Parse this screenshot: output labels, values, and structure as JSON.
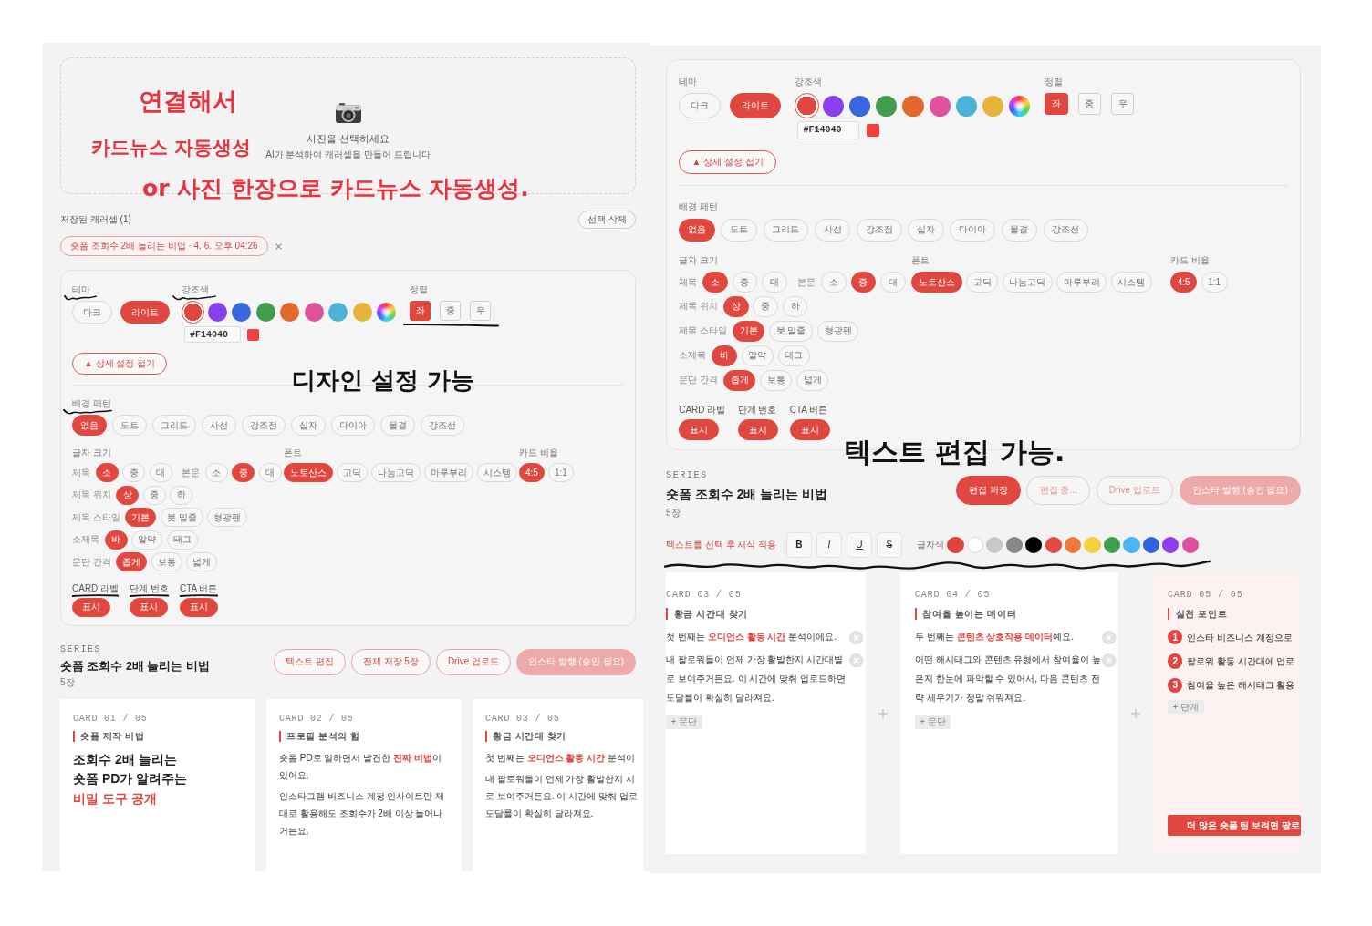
{
  "screens": [
    {
      "editing": false,
      "upload": {
        "title": "사진을 선택하세요",
        "subtitle": "AI가 분석하여 캐러셀을 만들어 드립니다"
      },
      "saved": {
        "label": "저장된 캐러셀 (1)",
        "delete_button": "선택 삭제",
        "items": [
          {
            "label": "숏폼 조회수 2배 늘리는 비법 · 4. 6. 오후 04:26"
          }
        ]
      },
      "settings": {
        "theme": {
          "label": "테마",
          "options": [
            {
              "label": "다크",
              "selected": false
            },
            {
              "label": "라이트",
              "selected": true
            }
          ]
        },
        "accent": {
          "label": "강조색",
          "swatches": [
            {
              "kind": "solid",
              "color": "#e2473f",
              "selected": true
            },
            {
              "kind": "solid",
              "color": "#8a40ee",
              "selected": false
            },
            {
              "kind": "solid",
              "color": "#3a66df",
              "selected": false
            },
            {
              "kind": "solid",
              "color": "#3f9d4b",
              "selected": false
            },
            {
              "kind": "solid",
              "color": "#e2682b",
              "selected": false
            },
            {
              "kind": "solid",
              "color": "#e0529c",
              "selected": false
            },
            {
              "kind": "solid",
              "color": "#4bb3d7",
              "selected": false
            },
            {
              "kind": "solid",
              "color": "#e6b43b",
              "selected": false
            },
            {
              "kind": "picker",
              "selected": false
            }
          ],
          "hex": "#F14040"
        },
        "align": {
          "label": "정렬",
          "options": [
            {
              "label": "좌",
              "selected": true
            },
            {
              "label": "중",
              "selected": false
            },
            {
              "label": "우",
              "selected": false
            }
          ]
        },
        "collapse_button": "▲ 상세 설정 접기",
        "pattern": {
          "label": "배경 패턴",
          "options": [
            {
              "label": "없음",
              "selected": true
            },
            {
              "label": "도트",
              "selected": false
            },
            {
              "label": "그리드",
              "selected": false
            },
            {
              "label": "사선",
              "selected": false
            },
            {
              "label": "강조점",
              "selected": false
            },
            {
              "label": "십자",
              "selected": false
            },
            {
              "label": "다이아",
              "selected": false
            },
            {
              "label": "물결",
              "selected": false
            },
            {
              "label": "강조선",
              "selected": false
            }
          ]
        },
        "text_options": {
          "label": "글자 크기",
          "rows": [
            {
              "groups": [
                {
                  "label": "제목",
                  "options": [
                    {
                      "label": "소",
                      "selected": true
                    },
                    {
                      "label": "중",
                      "selected": false
                    },
                    {
                      "label": "대",
                      "selected": false
                    }
                  ]
                },
                {
                  "label": "본문",
                  "options": [
                    {
                      "label": "소",
                      "selected": false
                    },
                    {
                      "label": "중",
                      "selected": true
                    },
                    {
                      "label": "대",
                      "selected": false
                    }
                  ]
                }
              ]
            },
            {
              "groups": [
                {
                  "label": "제목 위치",
                  "options": [
                    {
                      "label": "상",
                      "selected": true
                    },
                    {
                      "label": "중",
                      "selected": false
                    },
                    {
                      "label": "하",
                      "selected": false
                    }
                  ]
                }
              ]
            },
            {
              "groups": [
                {
                  "label": "제목 스타일",
                  "options": [
                    {
                      "label": "기본",
                      "selected": true
                    },
                    {
                      "label": "붓 밑줄",
                      "selected": false
                    },
                    {
                      "label": "형광펜",
                      "selected": false
                    }
                  ]
                }
              ]
            },
            {
              "groups": [
                {
                  "label": "소제목",
                  "options": [
                    {
                      "label": "바",
                      "selected": true
                    },
                    {
                      "label": "알약",
                      "selected": false
                    },
                    {
                      "label": "태그",
                      "selected": false
                    }
                  ]
                }
              ]
            },
            {
              "groups": [
                {
                  "label": "문단 간격",
                  "options": [
                    {
                      "label": "좁게",
                      "selected": true
                    },
                    {
                      "label": "보통",
                      "selected": false
                    },
                    {
                      "label": "넓게",
                      "selected": false
                    }
                  ]
                }
              ]
            }
          ]
        },
        "font": {
          "label": "폰트",
          "options": [
            {
              "label": "노토산스",
              "selected": true
            },
            {
              "label": "고딕",
              "selected": false
            },
            {
              "label": "나눔고딕",
              "selected": false
            },
            {
              "label": "마루부리",
              "selected": false
            },
            {
              "label": "시스템",
              "selected": false
            }
          ]
        },
        "ratio": {
          "label": "카드 비율",
          "options": [
            {
              "label": "4:5",
              "selected": true
            },
            {
              "label": "1:1",
              "selected": false
            }
          ]
        },
        "toggles": [
          {
            "label": "CARD 라벨",
            "button": "표시",
            "on": true
          },
          {
            "label": "단계 번호",
            "button": "표시",
            "on": true
          },
          {
            "label": "CTA 버튼",
            "button": "표시",
            "on": true
          }
        ]
      },
      "series": {
        "eyebrow": "SERIES",
        "title": "숏폼 조회수 2배 늘리는 비법",
        "count": "5장",
        "buttons": [
          {
            "label": "텍스트 편집",
            "kind": "outline"
          },
          {
            "label": "전체 저장 5장",
            "kind": "outline"
          },
          {
            "label": "Drive 업로드",
            "kind": "outline"
          },
          {
            "label": "인스타 발행 (승인 필요)",
            "kind": "disabled"
          }
        ]
      },
      "cards": [
        {
          "kind": "cover",
          "label": "CARD 01 / 05",
          "tag": "숏폼 제작 비법",
          "title_lines": [
            {
              "text": "조회수 2배 늘리는",
              "accent": false
            },
            {
              "text": "숏폼 PD가 알려주는",
              "accent": false
            },
            {
              "text": "비밀 도구 공개",
              "accent": true
            }
          ]
        },
        {
          "kind": "text",
          "label": "CARD 02 / 05",
          "tag": "프로필 분석의 힘",
          "paragraphs": [
            "숏폼 PD로 일하면서 발견한 **진짜 비법**이 있어요.",
            "인스타그램 비즈니스 계정 인사이트만 제대로 활용해도 조회수가 2배 이상 늘어나거든요."
          ]
        },
        {
          "kind": "text",
          "label": "CARD 03 / 05",
          "tag": "황금 시간대 찾기",
          "paragraphs": [
            "첫 번째는 **오디언스 활동 시간** 분석이",
            "내 팔로워들이 언제 가장 활발한지 시\n로 보여주거든요. 이 시간에 맞춰 업로\n도달률이 확실히 달라져요."
          ]
        }
      ]
    },
    {
      "editing": true,
      "settings": {
        "theme": {
          "label": "테마",
          "options": [
            {
              "label": "다크",
              "selected": false
            },
            {
              "label": "라이트",
              "selected": true
            }
          ]
        },
        "accent": {
          "label": "강조색",
          "swatches": [
            {
              "kind": "solid",
              "color": "#e2473f",
              "selected": true
            },
            {
              "kind": "solid",
              "color": "#8a40ee",
              "selected": false
            },
            {
              "kind": "solid",
              "color": "#3a66df",
              "selected": false
            },
            {
              "kind": "solid",
              "color": "#3f9d4b",
              "selected": false
            },
            {
              "kind": "solid",
              "color": "#e2682b",
              "selected": false
            },
            {
              "kind": "solid",
              "color": "#e0529c",
              "selected": false
            },
            {
              "kind": "solid",
              "color": "#4bb3d7",
              "selected": false
            },
            {
              "kind": "solid",
              "color": "#e6b43b",
              "selected": false
            },
            {
              "kind": "picker",
              "selected": false
            }
          ],
          "hex": "#F14040"
        },
        "align": {
          "label": "정렬",
          "options": [
            {
              "label": "좌",
              "selected": true
            },
            {
              "label": "중",
              "selected": false
            },
            {
              "label": "우",
              "selected": false
            }
          ]
        },
        "collapse_button": "▲ 상세 설정 접기",
        "pattern": {
          "label": "배경 패턴",
          "options": [
            {
              "label": "없음",
              "selected": true
            },
            {
              "label": "도트",
              "selected": false
            },
            {
              "label": "그리드",
              "selected": false
            },
            {
              "label": "사선",
              "selected": false
            },
            {
              "label": "강조점",
              "selected": false
            },
            {
              "label": "십자",
              "selected": false
            },
            {
              "label": "다이아",
              "selected": false
            },
            {
              "label": "물결",
              "selected": false
            },
            {
              "label": "강조선",
              "selected": false
            }
          ]
        },
        "text_options": {
          "label": "글자 크기",
          "rows": [
            {
              "groups": [
                {
                  "label": "제목",
                  "options": [
                    {
                      "label": "소",
                      "selected": true
                    },
                    {
                      "label": "중",
                      "selected": false
                    },
                    {
                      "label": "대",
                      "selected": false
                    }
                  ]
                },
                {
                  "label": "본문",
                  "options": [
                    {
                      "label": "소",
                      "selected": false
                    },
                    {
                      "label": "중",
                      "selected": true
                    },
                    {
                      "label": "대",
                      "selected": false
                    }
                  ]
                }
              ]
            },
            {
              "groups": [
                {
                  "label": "제목 위치",
                  "options": [
                    {
                      "label": "상",
                      "selected": true
                    },
                    {
                      "label": "중",
                      "selected": false
                    },
                    {
                      "label": "하",
                      "selected": false
                    }
                  ]
                }
              ]
            },
            {
              "groups": [
                {
                  "label": "제목 스타일",
                  "options": [
                    {
                      "label": "기본",
                      "selected": true
                    },
                    {
                      "label": "붓 밑줄",
                      "selected": false
                    },
                    {
                      "label": "형광펜",
                      "selected": false
                    }
                  ]
                }
              ]
            },
            {
              "groups": [
                {
                  "label": "소제목",
                  "options": [
                    {
                      "label": "바",
                      "selected": true
                    },
                    {
                      "label": "알약",
                      "selected": false
                    },
                    {
                      "label": "태그",
                      "selected": false
                    }
                  ]
                }
              ]
            },
            {
              "groups": [
                {
                  "label": "문단 간격",
                  "options": [
                    {
                      "label": "좁게",
                      "selected": true
                    },
                    {
                      "label": "보통",
                      "selected": false
                    },
                    {
                      "label": "넓게",
                      "selected": false
                    }
                  ]
                }
              ]
            }
          ]
        },
        "font": {
          "label": "폰트",
          "options": [
            {
              "label": "노토산스",
              "selected": true
            },
            {
              "label": "고딕",
              "selected": false
            },
            {
              "label": "나눔고딕",
              "selected": false
            },
            {
              "label": "마루부리",
              "selected": false
            },
            {
              "label": "시스템",
              "selected": false
            }
          ]
        },
        "ratio": {
          "label": "카드 비율",
          "options": [
            {
              "label": "4:5",
              "selected": true
            },
            {
              "label": "1:1",
              "selected": false
            }
          ]
        },
        "toggles": [
          {
            "label": "CARD 라벨",
            "button": "표시",
            "on": true
          },
          {
            "label": "단계 번호",
            "button": "표시",
            "on": true
          },
          {
            "label": "CTA 버튼",
            "button": "표시",
            "on": true
          }
        ]
      },
      "series": {
        "eyebrow": "SERIES",
        "title": "숏폼 조회수 2배 늘리는 비법",
        "count": "5장",
        "buttons": [
          {
            "label": "편집 저장",
            "kind": "primary"
          },
          {
            "label": "편집 중...",
            "kind": "muted"
          },
          {
            "label": "Drive 업로드",
            "kind": "muted"
          },
          {
            "label": "인스타 발행 (승인 필요)",
            "kind": "disabled"
          }
        ]
      },
      "format_bar": {
        "hint": "텍스트를 선택 후 서식 적용",
        "styles": [
          {
            "label": "B",
            "kind": "bold"
          },
          {
            "label": "I",
            "kind": "italic"
          },
          {
            "label": "U",
            "kind": "underline"
          },
          {
            "label": "S",
            "kind": "strike"
          }
        ],
        "color_label": "글자색",
        "colors": [
          {
            "color": "#dc453e"
          },
          {
            "color": "#ffffff"
          },
          {
            "color": "#c8c8c8"
          },
          {
            "color": "#888888"
          },
          {
            "color": "#000000"
          },
          {
            "color": "#e24b41"
          },
          {
            "color": "#ef7a3a"
          },
          {
            "color": "#f4cf3f"
          },
          {
            "color": "#3f9f4f"
          },
          {
            "color": "#4cb6f2"
          },
          {
            "color": "#3362e0"
          },
          {
            "color": "#8b3ff0"
          },
          {
            "color": "#e04e9e"
          }
        ]
      },
      "cards": [
        {
          "kind": "text",
          "label": "CARD 03 / 05",
          "tag": "황금 시간대 찾기",
          "paragraphs": [
            "첫 번째는 **오디언스 활동 시간** 분석이에요.",
            "내 팔로워들이 언제 가장 활발한지 시간대별로 보여주거든요. 이 시간에 맞춰 업로드하면 도달률이 확실히 달라져요."
          ],
          "add_button": "+ 문단"
        },
        {
          "kind": "text",
          "label": "CARD 04 / 05",
          "tag": "참여율 높이는 데이터",
          "paragraphs": [
            "두 번째는 **콘텐츠 상호작용 데이터**예요.",
            "어떤 해시태그와 콘텐츠 유형에서 참여율이 높은지 한눈에 파악할 수 있어서, 다음 콘텐츠 전략 세우기가 정말 쉬워져요."
          ],
          "add_button": "+ 문단"
        },
        {
          "kind": "steps",
          "label": "CARD 05 / 05",
          "tag": "실천 포인트",
          "steps": [
            {
              "number": "1",
              "text": "인스타 비즈니스 계정으로"
            },
            {
              "number": "2",
              "text": "팔로워 활동 시간대에 업로"
            },
            {
              "number": "3",
              "text": "참여율 높은 해시태그 활용"
            }
          ],
          "add_button": "+ 단계",
          "cta": "더 많은 숏폼 팁 보려면 팔로"
        }
      ]
    }
  ],
  "annotations": [
    {
      "text": "연결해서",
      "color": "#e8323e"
    },
    {
      "text": "카드뉴스 자동생성",
      "color": "#e8323e"
    },
    {
      "text": "or 사진 한장으로 카드뉴스 자동생성.",
      "color": "#e8323e"
    },
    {
      "text": "디자인 설정 가능",
      "color": "#111111"
    },
    {
      "text": "텍스트 편집 가능.",
      "color": "#111111"
    }
  ]
}
